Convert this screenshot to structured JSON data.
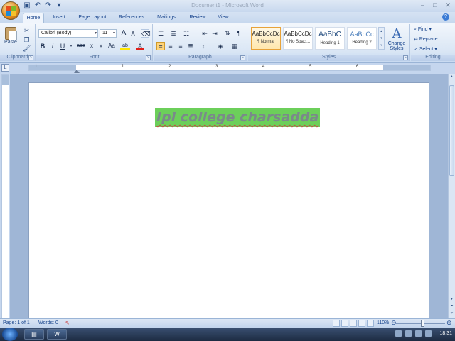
{
  "window": {
    "title": "Document1 - Microsoft Word",
    "controls": [
      "–",
      "□",
      "✕"
    ]
  },
  "quick_access": {
    "save_icon": "save-icon",
    "undo_icon": "undo-icon",
    "redo_icon": "redo-icon"
  },
  "tabs": [
    "Home",
    "Insert",
    "Page Layout",
    "References",
    "Mailings",
    "Review",
    "View"
  ],
  "active_tab": "Home",
  "ribbon": {
    "clipboard": {
      "label": "Clipboard",
      "paste_label": "Paste"
    },
    "font": {
      "label": "Font",
      "font_name": "Calibri (Body)",
      "font_size": "11",
      "grow": "A",
      "shrink": "A",
      "bold": "B",
      "italic": "I",
      "underline": "U",
      "strike": "abe",
      "subscript": "x",
      "superscript": "x",
      "change_case": "Aa",
      "highlight": "ab",
      "font_color": "A"
    },
    "paragraph": {
      "label": "Paragraph"
    },
    "styles": {
      "label": "Styles",
      "items": [
        {
          "sample": "AaBbCcDc",
          "name": "¶ Normal"
        },
        {
          "sample": "AaBbCcDc",
          "name": "¶ No Spaci..."
        },
        {
          "sample": "AaBbC",
          "name": "Heading 1"
        },
        {
          "sample": "AaBbCc",
          "name": "Heading 2"
        }
      ],
      "change_styles_line1": "Change",
      "change_styles_line2": "Styles"
    },
    "editing": {
      "label": "Editing",
      "find": "Find",
      "replace": "Replace",
      "select": "Select"
    }
  },
  "ruler": {
    "numbers": [
      "1",
      "1",
      "2",
      "3",
      "4",
      "5",
      "6"
    ]
  },
  "document": {
    "text": "Ipl college charsadda",
    "highlight_color": "#6ccf5a"
  },
  "statusbar": {
    "page": "Page: 1 of 1",
    "words": "Words: 0",
    "zoom": "110%"
  },
  "taskbar": {
    "clock": "18:31",
    "word_button": "W"
  }
}
